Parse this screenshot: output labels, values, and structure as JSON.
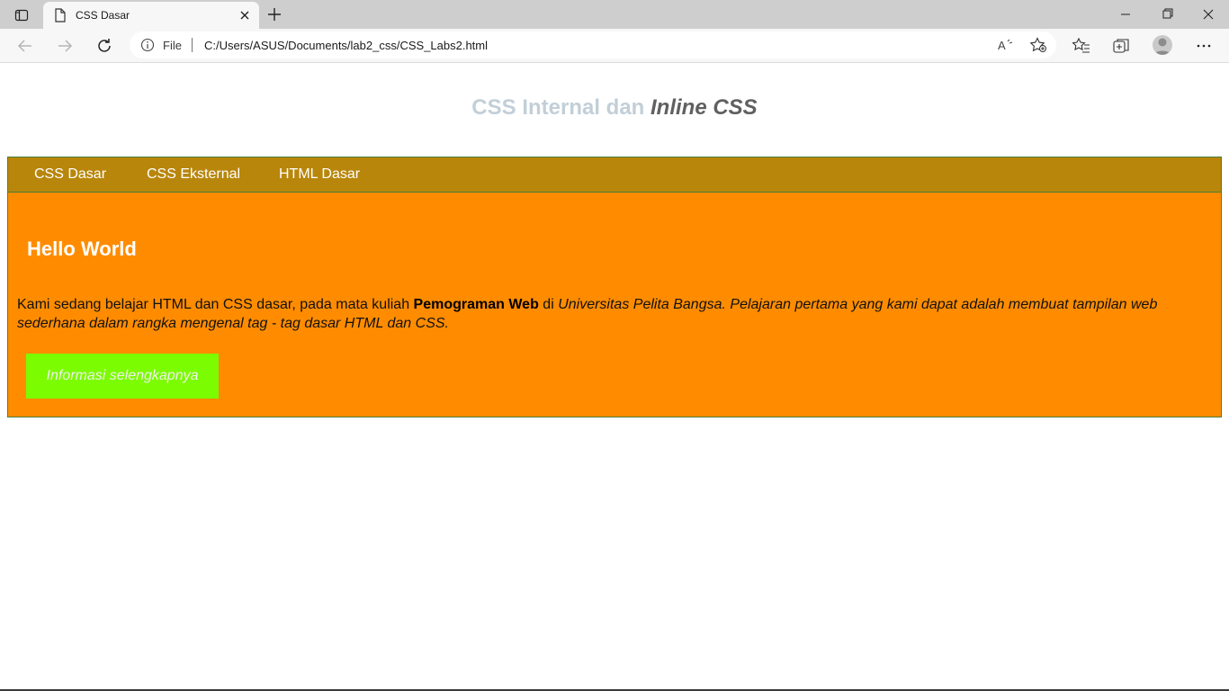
{
  "browser": {
    "tab_title": "CSS Dasar",
    "address": {
      "file_label": "File",
      "url": "C:/Users/ASUS/Documents/lab2_css/CSS_Labs2.html"
    }
  },
  "page": {
    "title_part1": "CSS Internal dan ",
    "title_part2": "Inline CSS",
    "nav": [
      "CSS Dasar",
      "CSS Eksternal",
      "HTML Dasar"
    ],
    "heading": "Hello World",
    "paragraph": {
      "text1": "Kami sedang belajar HTML dan CSS dasar, pada mata kuliah ",
      "bold": "Pemograman Web",
      "text2": " di ",
      "italic": "Universitas Pelita Bangsa. Pelajaran pertama yang kami dapat adalah membuat tampilan web sederhana dalam rangka mengenal tag - tag dasar HTML dan CSS."
    },
    "button_label": "Informasi selengkapnya"
  },
  "colors": {
    "navbar_bg": "#b8860b",
    "content_bg": "#ff8c00",
    "button_bg": "#7cfc00",
    "title_color": "#c2cfd8",
    "title_inline_color": "#606060"
  }
}
